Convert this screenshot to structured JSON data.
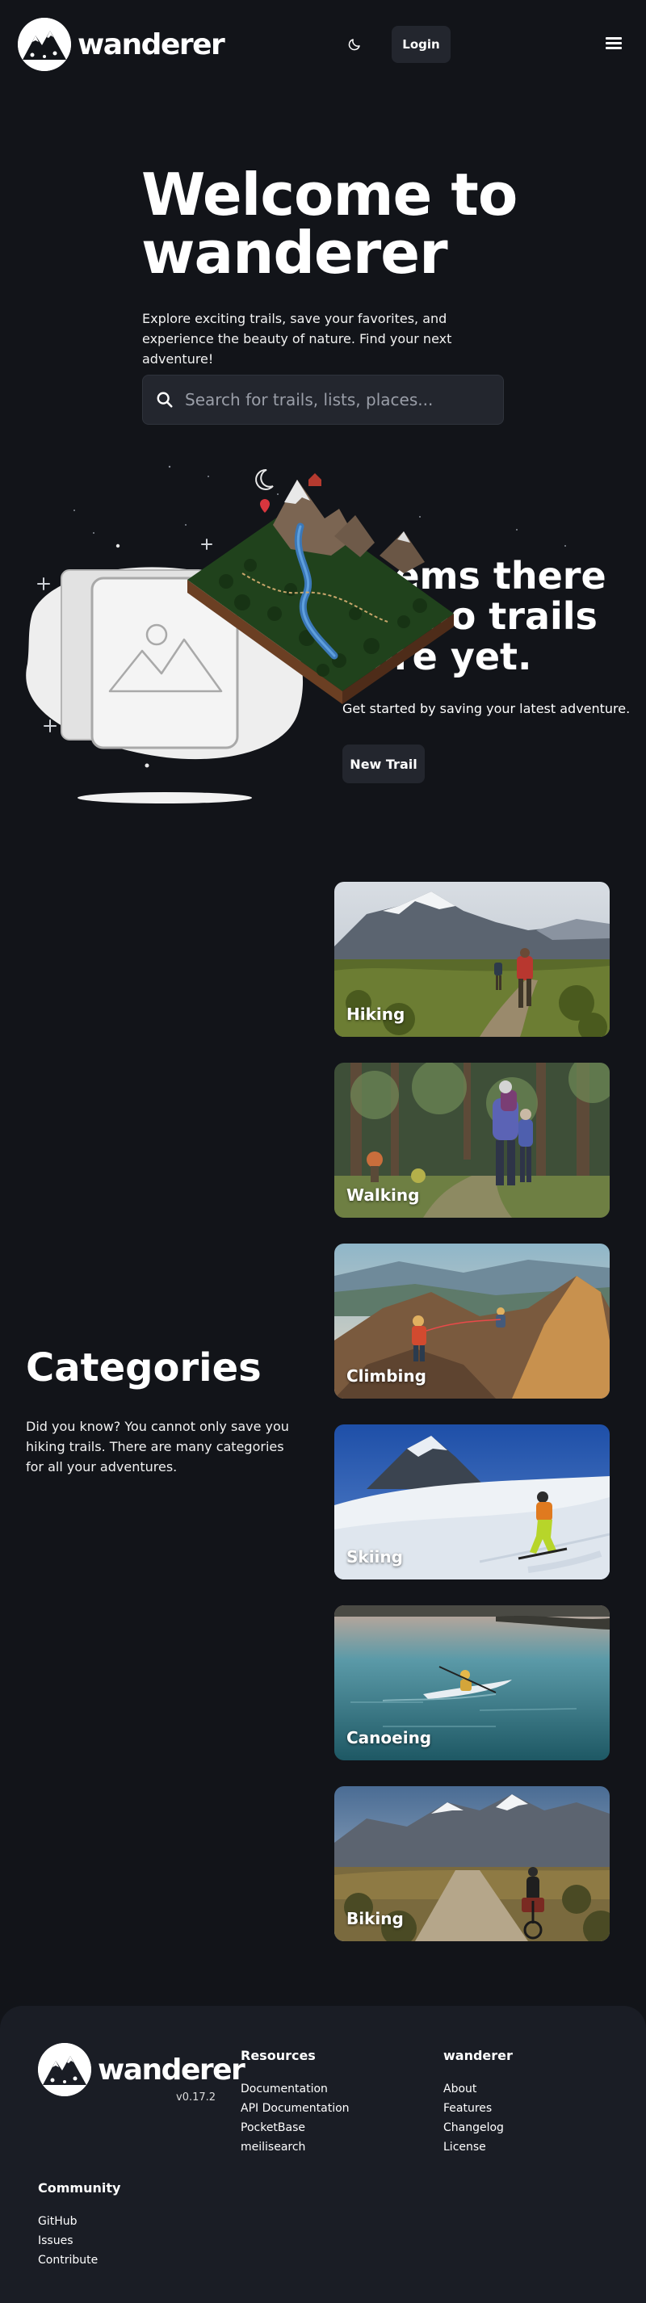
{
  "brand": {
    "name": "wanderer"
  },
  "nav": {
    "login_label": "Login"
  },
  "hero": {
    "title": "Welcome to wanderer",
    "subtitle": "Explore exciting trails, save your favorites, and experience the beauty of nature. Find your next adventure!",
    "search_placeholder": "Search for trails, lists, places..."
  },
  "empty_state": {
    "heading": "Seems there are no trails here yet.",
    "subtitle": "Get started by saving your latest adventure.",
    "button_label": "New Trail"
  },
  "categories": {
    "title": "Categories",
    "description": "Did you know? You cannot only save you hiking trails. There are many categories for all your adventures.",
    "items": [
      {
        "label": "Hiking"
      },
      {
        "label": "Walking"
      },
      {
        "label": "Climbing"
      },
      {
        "label": "Skiing"
      },
      {
        "label": "Canoeing"
      },
      {
        "label": "Biking"
      }
    ]
  },
  "footer": {
    "brand": "wanderer",
    "version": "v0.17.2",
    "resources": {
      "title": "Resources",
      "links": [
        "Documentation",
        "API Documentation",
        "PocketBase",
        "meilisearch"
      ]
    },
    "wanderer": {
      "title": "wanderer",
      "links": [
        "About",
        "Features",
        "Changelog",
        "License"
      ]
    },
    "community": {
      "title": "Community",
      "links": [
        "GitHub",
        "Issues",
        "Contribute"
      ]
    }
  },
  "icons": {
    "theme_toggle": "moon-icon",
    "menu": "hamburger-menu-icon",
    "search": "search-icon"
  }
}
